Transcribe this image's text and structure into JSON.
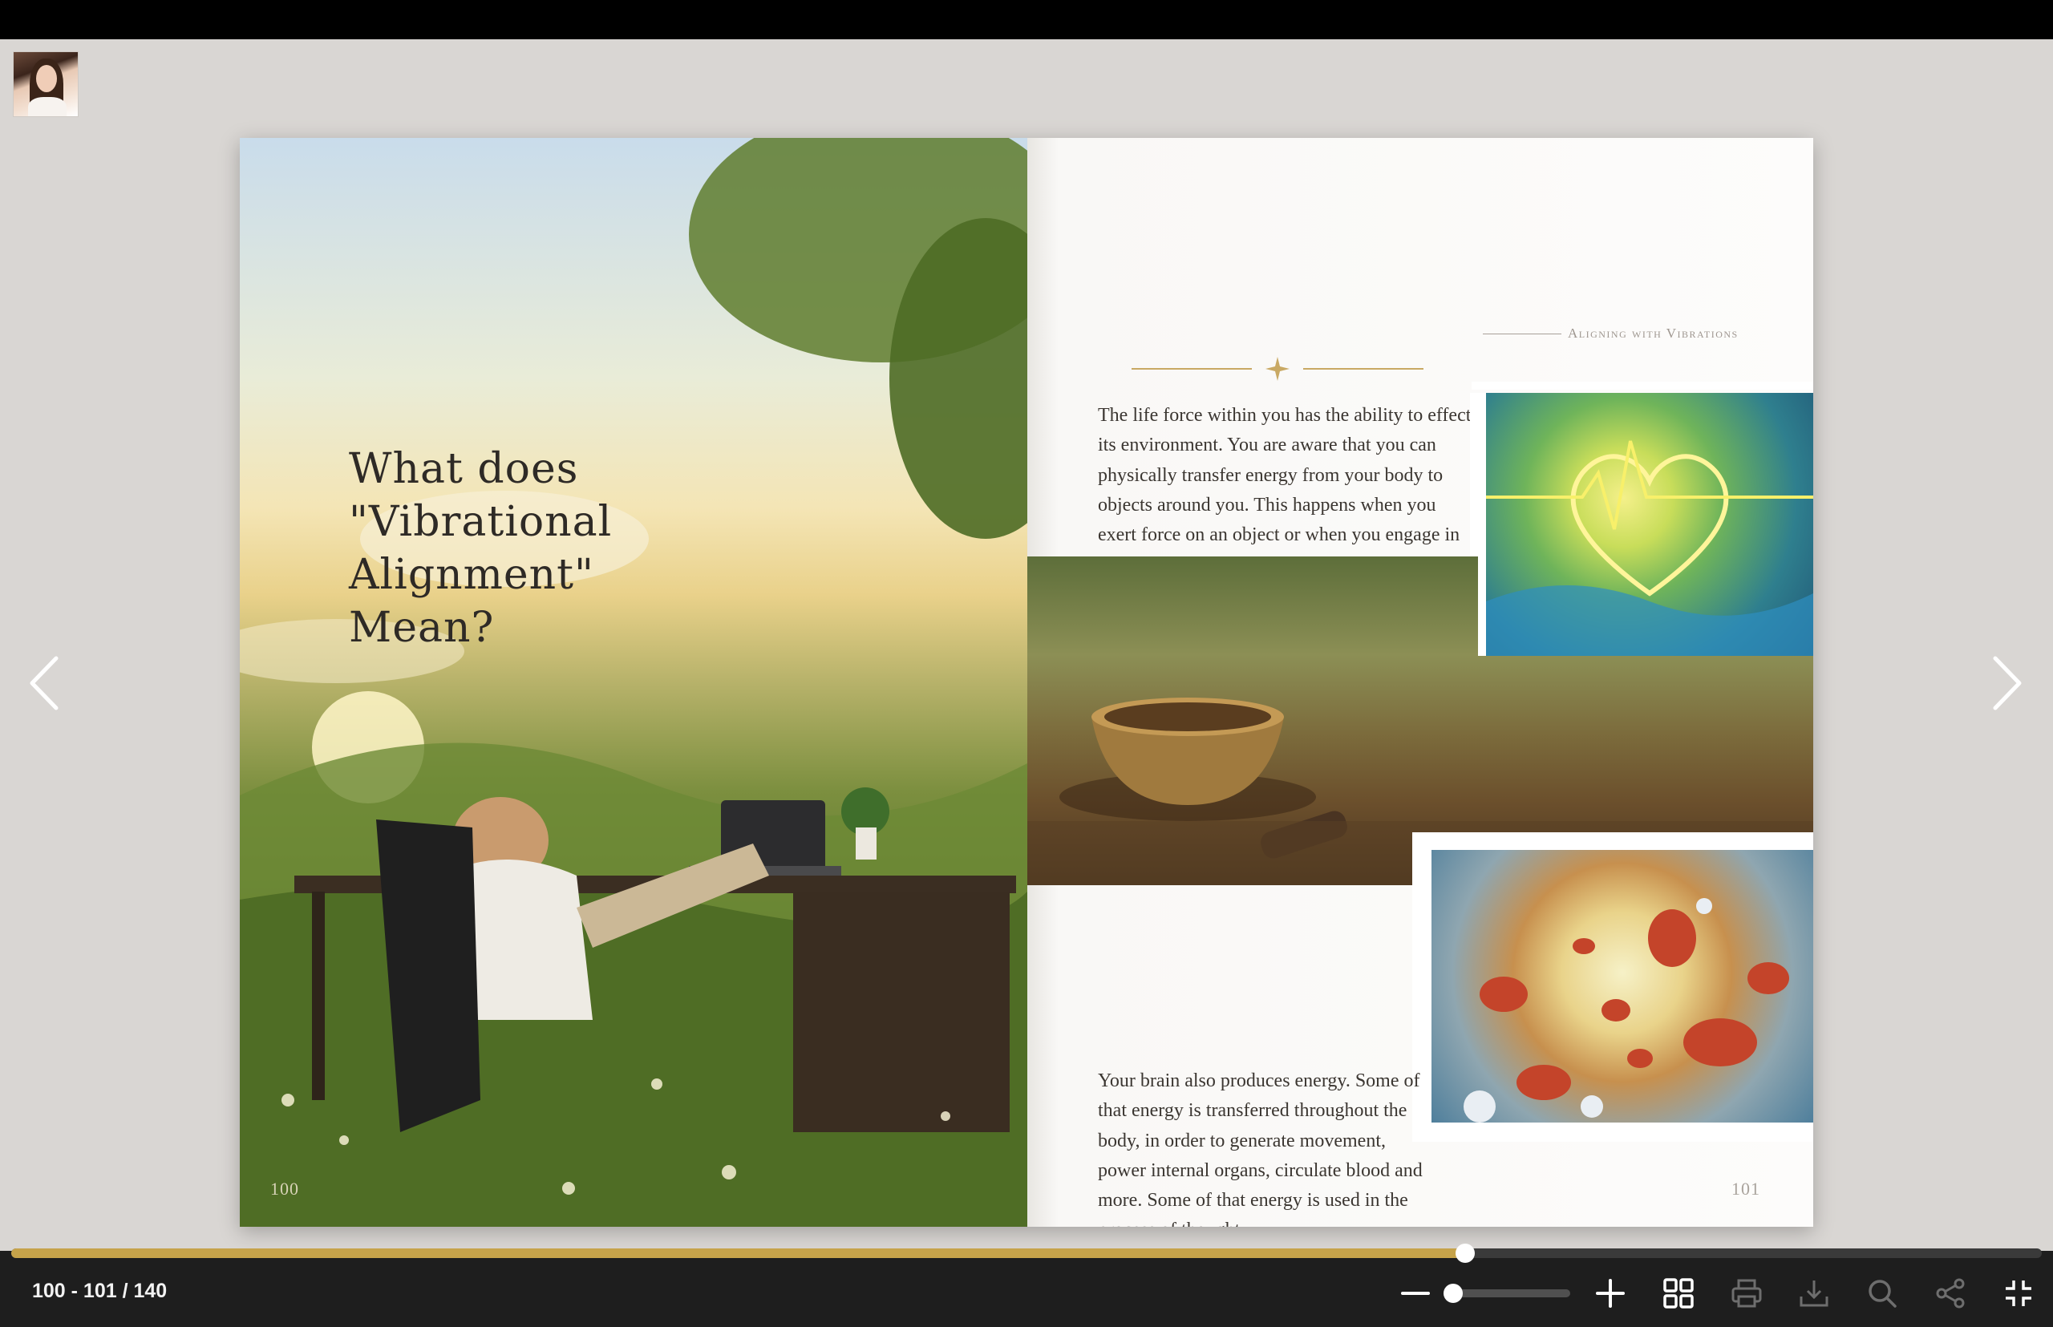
{
  "viewer": {
    "page_counter": "100 - 101 / 140",
    "progress_fraction": 0.716,
    "zoom_fraction": 0.0,
    "accent_color": "#c6a34a"
  },
  "spread": {
    "left_page": {
      "title_lines": [
        "What does",
        "\"Vibrational Alignment\"",
        "Mean?"
      ],
      "page_number": "100"
    },
    "right_page": {
      "running_head": "Aligning with Vibrations",
      "paragraph_1": "The life force within you has the ability to effect its environment. You are aware that you can physically transfer energy from your body to objects around you. This happens when you exert force on an object or when you engage in some sort of physical activity or work. You also have the ability to produce sound and motion. Your amazing body can even generate heat.",
      "paragraph_2": "Your brain also produces energy. Some of that energy is transferred throughout the body, in order to generate movement, power internal organs, circulate blood and more. Some of that energy is used in the process of thought.",
      "page_number": "101"
    }
  },
  "icons": {
    "prev": "chevron-left-icon",
    "next": "chevron-right-icon",
    "zoom_out": "minus-icon",
    "zoom_in": "plus-icon",
    "thumbnails": "grid-icon",
    "print": "print-icon",
    "download": "download-icon",
    "search": "search-icon",
    "share": "share-icon",
    "fullscreen_exit": "exit-fullscreen-icon"
  }
}
